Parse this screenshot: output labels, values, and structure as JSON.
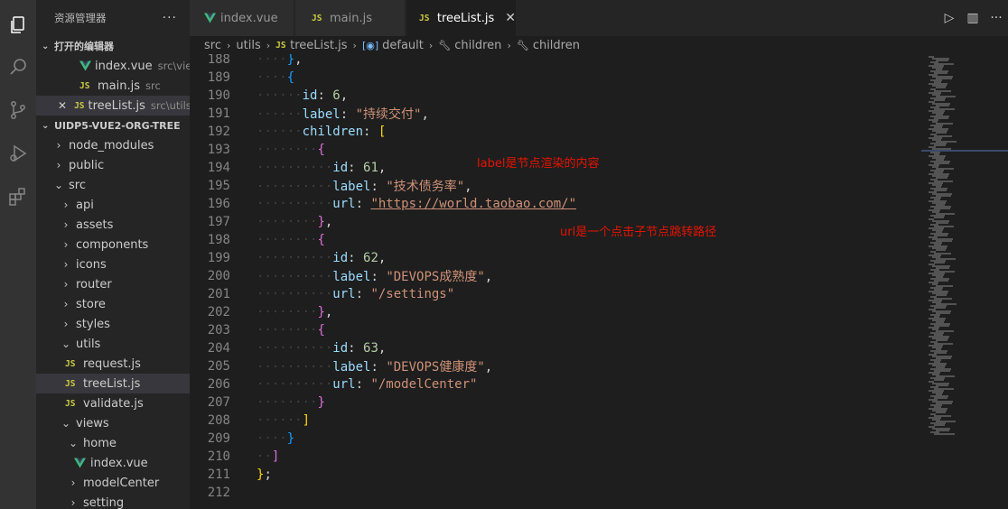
{
  "sidebar": {
    "title": "资源管理器",
    "more": "···",
    "open_editors_title": "打开的编辑器",
    "open_editors": [
      {
        "name": "index.vue",
        "desc": "src\\vie...",
        "type": "vue"
      },
      {
        "name": "main.js",
        "desc": "src",
        "type": "js"
      },
      {
        "name": "treeList.js",
        "desc": "src\\utils",
        "type": "js",
        "close": "✕"
      }
    ],
    "project_title": "UIDP5-VUE2-ORG-TREE",
    "tree": [
      {
        "name": "node_modules",
        "kind": "folder",
        "open": false
      },
      {
        "name": "public",
        "kind": "folder",
        "open": false
      },
      {
        "name": "src",
        "kind": "folder",
        "open": true
      },
      {
        "name": "api",
        "kind": "folder",
        "open": false
      },
      {
        "name": "assets",
        "kind": "folder",
        "open": false
      },
      {
        "name": "components",
        "kind": "folder",
        "open": false
      },
      {
        "name": "icons",
        "kind": "folder",
        "open": false
      },
      {
        "name": "router",
        "kind": "folder",
        "open": false
      },
      {
        "name": "store",
        "kind": "folder",
        "open": false
      },
      {
        "name": "styles",
        "kind": "folder",
        "open": false
      },
      {
        "name": "utils",
        "kind": "folder",
        "open": true
      },
      {
        "name": "request.js",
        "kind": "js"
      },
      {
        "name": "treeList.js",
        "kind": "js"
      },
      {
        "name": "validate.js",
        "kind": "js"
      },
      {
        "name": "views",
        "kind": "folder",
        "open": true
      },
      {
        "name": "home",
        "kind": "folder",
        "open": true
      },
      {
        "name": "index.vue",
        "kind": "vue"
      },
      {
        "name": "modelCenter",
        "kind": "folder",
        "open": false
      },
      {
        "name": "setting",
        "kind": "folder",
        "open": false
      }
    ]
  },
  "tabs": [
    {
      "label": "index.vue",
      "type": "vue"
    },
    {
      "label": "main.js",
      "type": "js"
    },
    {
      "label": "treeList.js",
      "type": "js",
      "close": "✕"
    }
  ],
  "breadcrumb": [
    "src",
    "utils",
    "treeList.js",
    "default",
    "children",
    "children"
  ],
  "editor": {
    "lines": [
      {
        "num": "188",
        "text": "},"
      },
      {
        "num": "189",
        "text": "{"
      },
      {
        "num": "190",
        "key": "id",
        "value": "6",
        "vtype": "n"
      },
      {
        "num": "191",
        "key": "label",
        "value": "\"持续交付\"",
        "vtype": "s"
      },
      {
        "num": "192",
        "key": "children",
        "value": "[",
        "vtype": "p"
      },
      {
        "num": "193",
        "text": "{"
      },
      {
        "num": "194",
        "key": "id",
        "value": "61",
        "vtype": "n"
      },
      {
        "num": "195",
        "key": "label",
        "value": "\"技术债务率\"",
        "vtype": "s"
      },
      {
        "num": "196",
        "key": "url",
        "value": "\"https://world.taobao.com/\"",
        "vtype": "u"
      },
      {
        "num": "197",
        "text": "},"
      },
      {
        "num": "198",
        "text": "{"
      },
      {
        "num": "199",
        "key": "id",
        "value": "62",
        "vtype": "n"
      },
      {
        "num": "200",
        "key": "label",
        "value": "\"DEVOPS成熟度\"",
        "vtype": "s"
      },
      {
        "num": "201",
        "key": "url",
        "value": "\"/settings\"",
        "vtype": "s"
      },
      {
        "num": "202",
        "text": "},"
      },
      {
        "num": "203",
        "text": "{"
      },
      {
        "num": "204",
        "key": "id",
        "value": "63",
        "vtype": "n"
      },
      {
        "num": "205",
        "key": "label",
        "value": "\"DEVOPS健康度\"",
        "vtype": "s"
      },
      {
        "num": "206",
        "key": "url",
        "value": "\"/modelCenter\"",
        "vtype": "s"
      },
      {
        "num": "207",
        "text": "}"
      },
      {
        "num": "208",
        "text": "]"
      },
      {
        "num": "209",
        "text": "}"
      },
      {
        "num": "210",
        "text": "]"
      },
      {
        "num": "211",
        "text": "};"
      },
      {
        "num": "212",
        "text": ""
      }
    ],
    "annotation_label": "label是节点渲染的内容",
    "annotation_url": "url是一个点击子节点跳转路径"
  },
  "colors": {
    "accent_js": "#cbcb41",
    "accent_vue": "#41b883",
    "annotation": "#e51400"
  }
}
